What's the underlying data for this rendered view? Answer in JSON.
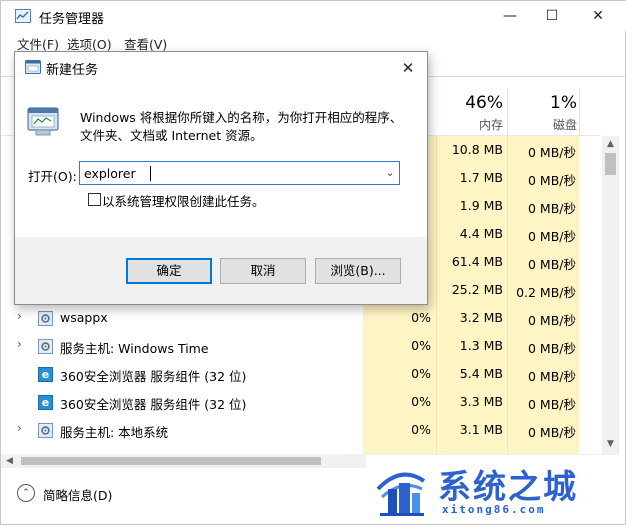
{
  "window": {
    "title": "任务管理器",
    "minimize_glyph": "—",
    "maximize_glyph": "☐",
    "close_glyph": "✕"
  },
  "menu": {
    "file": "文件(F)",
    "options": "选项(O)",
    "view": "查看(V)"
  },
  "columns": {
    "memory": {
      "percent": "46%",
      "label": "内存"
    },
    "disk": {
      "percent": "1%",
      "label": "磁盘"
    }
  },
  "rows": [
    {
      "name": "",
      "expandable": false,
      "icon": "none",
      "cpu": "",
      "memory": "10.8 MB",
      "disk": "0 MB/秒"
    },
    {
      "name": "",
      "expandable": false,
      "icon": "none",
      "cpu": "",
      "memory": "1.7 MB",
      "disk": "0 MB/秒"
    },
    {
      "name": "",
      "expandable": false,
      "icon": "none",
      "cpu": "",
      "memory": "1.9 MB",
      "disk": "0 MB/秒"
    },
    {
      "name": "",
      "expandable": false,
      "icon": "none",
      "cpu": "",
      "memory": "4.4 MB",
      "disk": "0 MB/秒"
    },
    {
      "name": "",
      "expandable": false,
      "icon": "none",
      "cpu": "",
      "memory": "61.4 MB",
      "disk": "0 MB/秒"
    },
    {
      "name": "",
      "expandable": false,
      "icon": "none",
      "cpu": "",
      "memory": "25.2 MB",
      "disk": "0.2 MB/秒"
    },
    {
      "name": "wsappx",
      "expandable": true,
      "icon": "gear-icon",
      "cpu": "0%",
      "memory": "3.2 MB",
      "disk": "0 MB/秒"
    },
    {
      "name": "服务主机: Windows Time",
      "expandable": true,
      "icon": "gear-icon",
      "cpu": "0%",
      "memory": "1.3 MB",
      "disk": "0 MB/秒"
    },
    {
      "name": "360安全浏览器 服务组件 (32 位)",
      "expandable": false,
      "icon": "browser-icon",
      "cpu": "0%",
      "memory": "5.4 MB",
      "disk": "0 MB/秒"
    },
    {
      "name": "360安全浏览器 服务组件 (32 位)",
      "expandable": false,
      "icon": "browser-icon",
      "cpu": "0%",
      "memory": "3.3 MB",
      "disk": "0 MB/秒"
    },
    {
      "name": "服务主机: 本地系统",
      "expandable": true,
      "icon": "gear-icon",
      "cpu": "0%",
      "memory": "3.1 MB",
      "disk": "0 MB/秒"
    }
  ],
  "footer": {
    "fewer_details": "简略信息(D)"
  },
  "run_dialog": {
    "title": "新建任务",
    "description_line1": "Windows 将根据你所键入的名称，为你打开相应的程序、",
    "description_line2": "文件夹、文档或 Internet 资源。",
    "open_label": "打开(O):",
    "open_value": "explorer",
    "admin_checkbox_label": "以系统管理权限创建此任务。",
    "admin_checked": false,
    "ok_label": "确定",
    "cancel_label": "取消",
    "browse_label": "浏览(B)..."
  },
  "watermark": {
    "text": "系统之城",
    "url": "xitong86.com"
  },
  "colors": {
    "column_highlight": "#fff4c4",
    "focus_border": "#0078d7",
    "watermark_blue": "#2b62d0"
  }
}
